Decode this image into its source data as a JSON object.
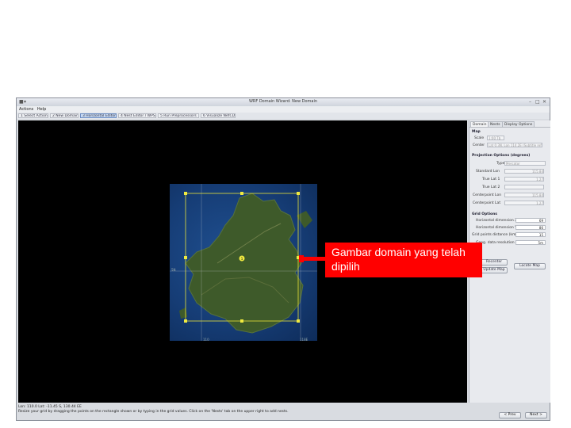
{
  "window": {
    "title": "WRF Domain Wizard: New Domain",
    "controls": [
      "–",
      "□",
      "✕"
    ]
  },
  "menu": [
    "Actions",
    "Help"
  ],
  "steps": [
    {
      "label": "1 Select Action"
    },
    {
      "label": "2 New Domain"
    },
    {
      "label": "3 Horizontal Editor"
    },
    {
      "label": "4 Nest Editor / WPS"
    },
    {
      "label": "5 Run Preprocessors"
    },
    {
      "label": "6 Visualize NetCDF"
    }
  ],
  "sidebar": {
    "tabs": [
      "Domain",
      "Nests",
      "Display Options"
    ],
    "map_group": "Map",
    "map_scale_label": "Scale",
    "map_scale_value": "1:00 Tb",
    "map_center_label": "Center",
    "map_center_value": "Lat 0.3N, Lon 114.2E (Subtitle ref)",
    "projection_group": "Projection Options (degrees)",
    "projection_rows": [
      {
        "label": "Type",
        "value": "Mercator"
      },
      {
        "label": "Standard Lon",
        "value": "115.84"
      },
      {
        "label": "True Lat 1",
        "value": "1.27"
      },
      {
        "label": "True Lat 2",
        "value": ""
      },
      {
        "label": "Centerpoint Lon",
        "value": "115.84"
      },
      {
        "label": "Centerpoint Lat",
        "value": "1.27"
      }
    ],
    "grid_group": "Grid Options",
    "grid_rows": [
      {
        "label": "Horizontal dimension X",
        "value": "69"
      },
      {
        "label": "Horizontal dimension Y",
        "value": "86"
      },
      {
        "label": "Grid points distance (km)",
        "value": "15"
      },
      {
        "label": "Geog. data resolution",
        "value": "5m"
      }
    ],
    "button_recenter": "Recenter",
    "button_update": "Update Map",
    "button_locate": "Locate Map"
  },
  "status": {
    "line1": "Lon: 110.0  Lat: -11.45 S, 130.44 EE",
    "line2": "Resize your grid by dragging the points on the rectangle shown or by typing in the grid values. Click on the 'Nests' tab on the upper right to add nests."
  },
  "nav": {
    "prev": "< Prev",
    "next": "Next >"
  },
  "map": {
    "domain_label": "1",
    "coord_labels": [
      "110",
      "5N",
      "118E"
    ]
  },
  "callout": {
    "text": "Gambar domain yang telah dipilih"
  }
}
